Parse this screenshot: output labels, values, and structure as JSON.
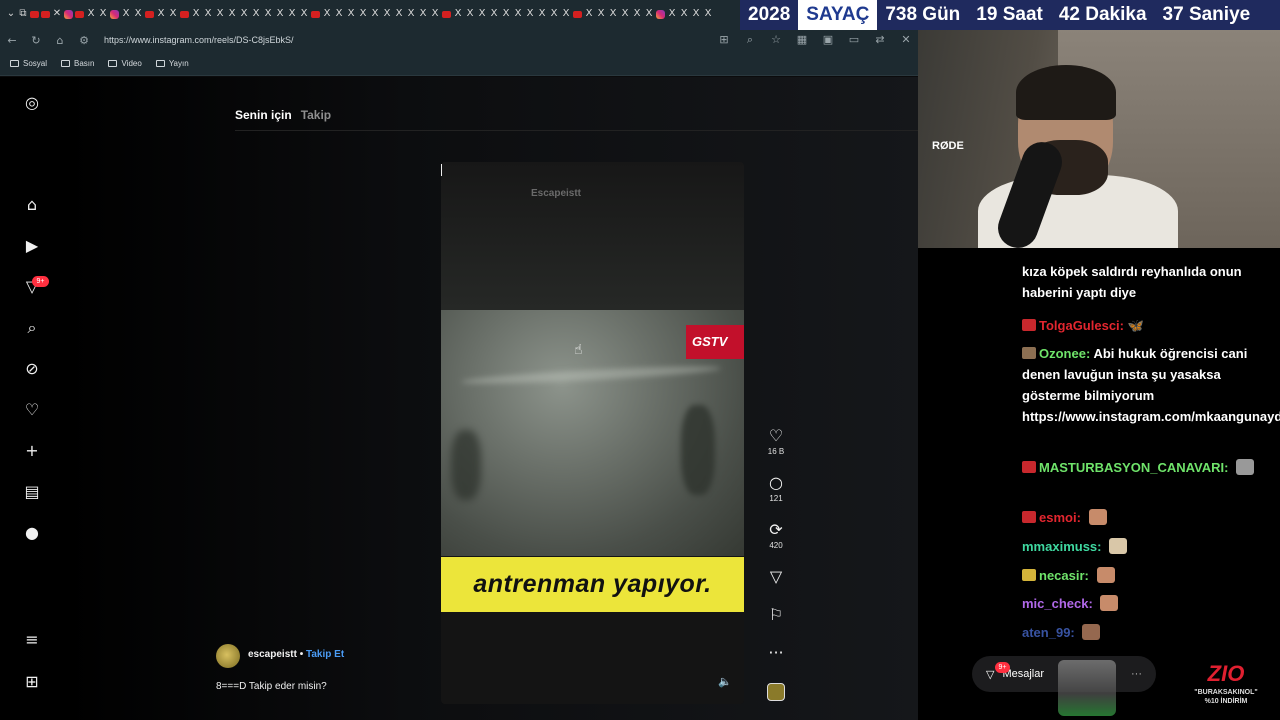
{
  "browser": {
    "url": "https://www.instagram.com/reels/DS-C8jsEbkS/",
    "bookmarks": [
      "Sosyal",
      "Basın",
      "Video",
      "Yayın"
    ]
  },
  "counter": {
    "year": "2028",
    "label": "SAYAÇ",
    "days": "738 Gün",
    "hours": "19 Saat",
    "minutes": "42 Dakika",
    "seconds": "37 Saniye"
  },
  "instagram": {
    "notification_badge": "9+",
    "tabs": {
      "for_you": "Senin için",
      "following": "Takip"
    },
    "video": {
      "watermark": "Escapeistt",
      "channel_logo": "GSTV",
      "banner_text": "antrenman yapıyor."
    },
    "actions": {
      "likes": "16 B",
      "comments": "121",
      "reposts": "420"
    },
    "author": {
      "username": "escapeistt",
      "separator": "•",
      "follow_label": "Takip Et",
      "caption": "8===D Takip eder misin?"
    },
    "messages": {
      "label": "Mesajlar",
      "badge": "9+"
    }
  },
  "webcam": {
    "mic_brand": "RØDE"
  },
  "chat": {
    "lines": [
      {
        "user": "",
        "text": "kıza köpek saldırdı reyhanlıda onun haberini yaptı diye",
        "color": "#ffffff"
      },
      {
        "user": "TolgaGulesci:",
        "text": "",
        "color": "#e3262f"
      },
      {
        "user": "Ozonee:",
        "text": "Abi hukuk öğrencisi cani denen lavuğun insta şu yasaksa gösterme bilmiyorum https://www.instagram.com/mkaangunaydin/",
        "color": "#6fe36a"
      },
      {
        "user": "MASTURBASYON_CANAVARI:",
        "text": "",
        "color": "#6fe36a"
      },
      {
        "user": "esmoi:",
        "text": "",
        "color": "#e3262f"
      },
      {
        "user": "mmaximuss:",
        "text": "",
        "color": "#3fd8a0"
      },
      {
        "user": "necasir:",
        "text": "",
        "color": "#6fe36a"
      },
      {
        "user": "mic_check:",
        "text": "",
        "color": "#b068e8"
      },
      {
        "user": "aten_99:",
        "text": "",
        "color": "#4b6fd8"
      }
    ]
  },
  "sponsor": {
    "logo": "ZIO",
    "code": "\"BURAKSAKINOL\"",
    "discount": "%10 İNDİRİM"
  }
}
